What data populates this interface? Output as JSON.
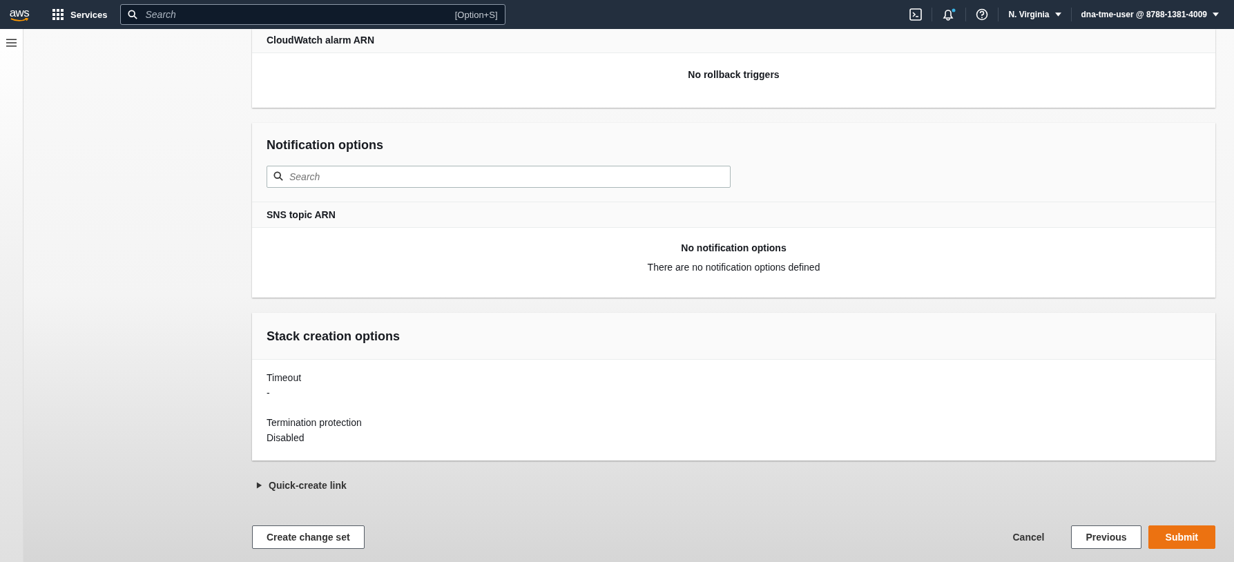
{
  "top_nav": {
    "logo": "aws",
    "services": "Services",
    "search": {
      "placeholder": "Search",
      "shortcut": "[Option+S]"
    },
    "notifications": {
      "unread": true
    },
    "region": "N. Virginia",
    "account": "dna-tme-user @ 8788-1381-4009"
  },
  "rollback": {
    "column": "CloudWatch alarm ARN",
    "empty": "No rollback triggers"
  },
  "notification": {
    "title": "Notification options",
    "search": {
      "placeholder": "Search"
    },
    "column": "SNS topic ARN",
    "empty_title": "No notification options",
    "empty_text": "There are no notification options defined"
  },
  "stack_creation": {
    "title": "Stack creation options",
    "fields": [
      {
        "label": "Timeout",
        "value": "-"
      },
      {
        "label": "Termination protection",
        "value": "Disabled"
      }
    ]
  },
  "quick_create": {
    "label": "Quick-create link",
    "expanded": false
  },
  "actions": [
    {
      "kind": "normal",
      "label": "Create change set"
    },
    {
      "kind": "link",
      "label": "Cancel"
    },
    {
      "kind": "normal",
      "label": "Previous"
    },
    {
      "kind": "primary",
      "label": "Submit"
    }
  ]
}
